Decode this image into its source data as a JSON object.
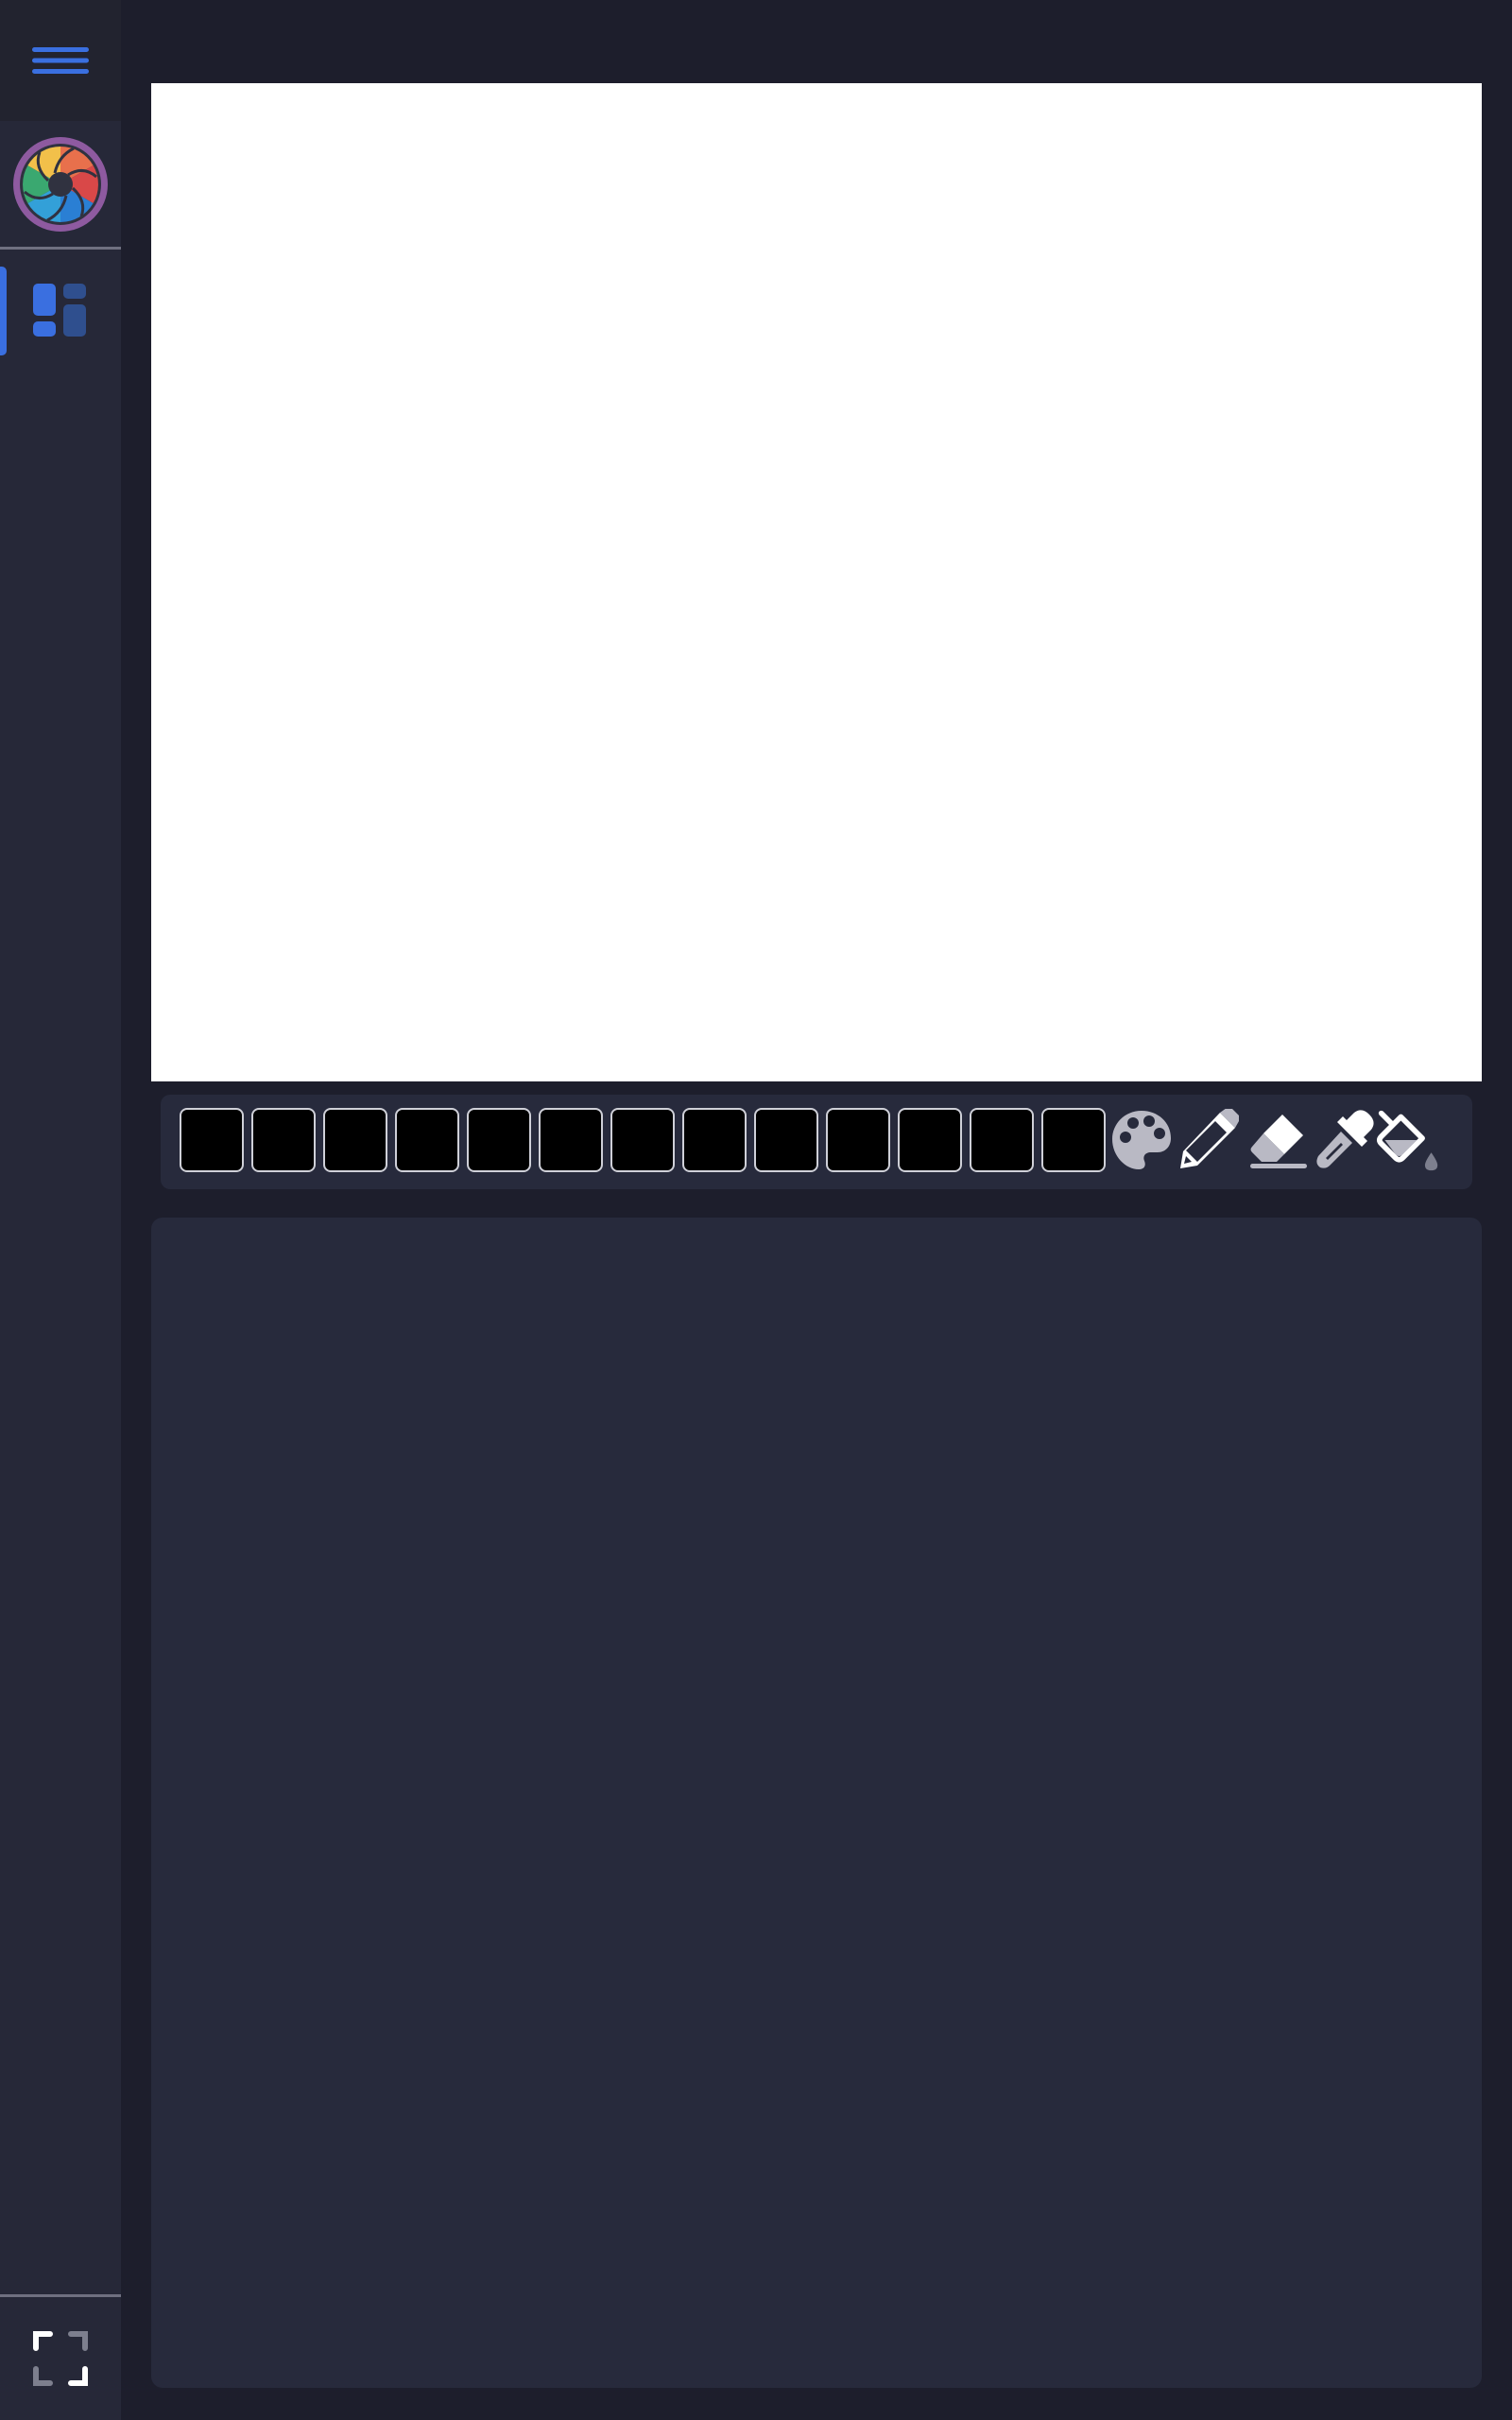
{
  "sidebar": {
    "menu_icon": "hamburger-menu-icon",
    "logo_icon": "camera-aperture-logo",
    "nav_items": [
      {
        "icon": "dashboard-icon",
        "active": true
      }
    ],
    "footer_icon": "fullscreen-icon"
  },
  "canvas": {
    "background": "#ffffff"
  },
  "toolbar": {
    "swatches": [
      "#000000",
      "#000000",
      "#000000",
      "#000000",
      "#000000",
      "#000000",
      "#000000",
      "#000000",
      "#000000",
      "#000000",
      "#000000",
      "#000000",
      "#000000"
    ],
    "tools": [
      "palette-icon",
      "pencil-icon",
      "eraser-icon",
      "eyedropper-icon",
      "fill-bucket-icon"
    ]
  },
  "colors": {
    "accent": "#3a6fe0",
    "sidebar_bg": "#262838",
    "page_bg": "#1d1e2c",
    "panel_bg": "#272a3c",
    "icon_gray": "#b9b9c4"
  }
}
